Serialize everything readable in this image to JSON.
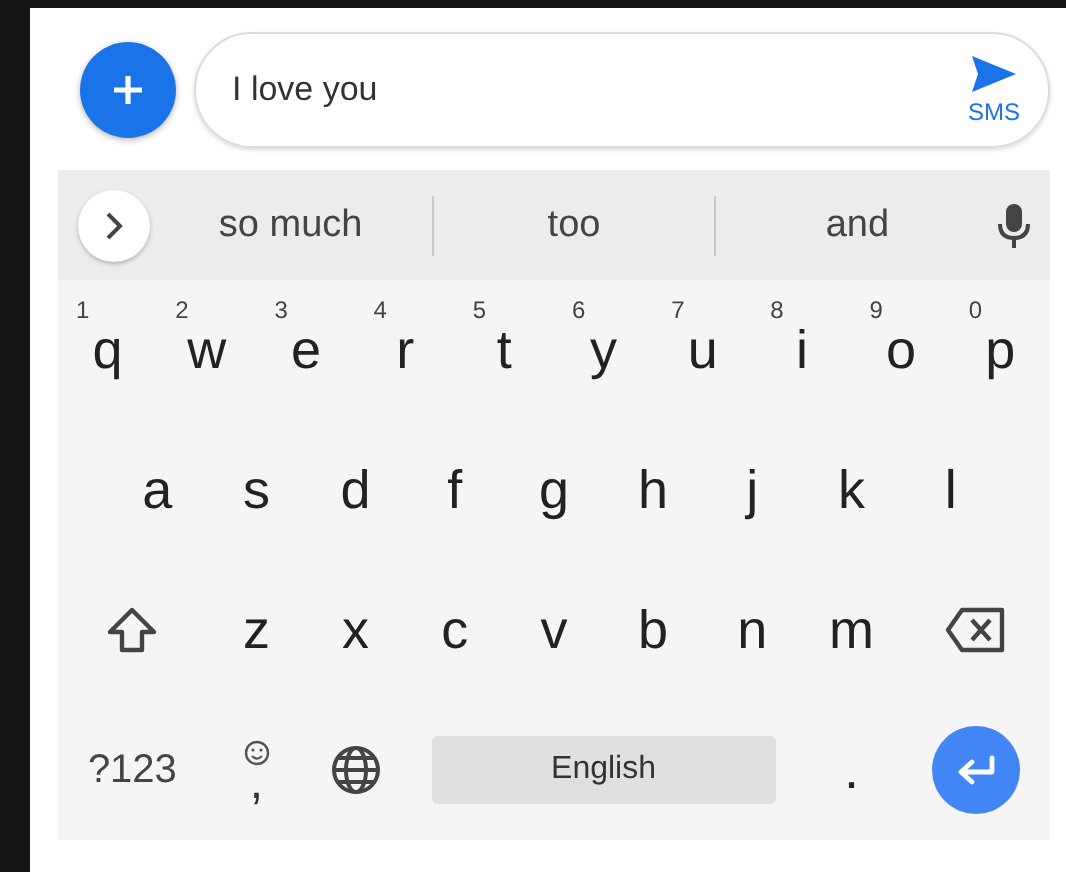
{
  "compose": {
    "value": "I love you",
    "send_label": "SMS"
  },
  "suggestions": [
    "so much",
    "too",
    "and"
  ],
  "keyboard": {
    "rows": [
      {
        "keys": [
          {
            "kind": "letter",
            "label": "q",
            "hint": "1"
          },
          {
            "kind": "letter",
            "label": "w",
            "hint": "2"
          },
          {
            "kind": "letter",
            "label": "e",
            "hint": "3"
          },
          {
            "kind": "letter",
            "label": "r",
            "hint": "4"
          },
          {
            "kind": "letter",
            "label": "t",
            "hint": "5"
          },
          {
            "kind": "letter",
            "label": "y",
            "hint": "6"
          },
          {
            "kind": "letter",
            "label": "u",
            "hint": "7"
          },
          {
            "kind": "letter",
            "label": "i",
            "hint": "8"
          },
          {
            "kind": "letter",
            "label": "o",
            "hint": "9"
          },
          {
            "kind": "letter",
            "label": "p",
            "hint": "0"
          }
        ]
      },
      {
        "keys": [
          {
            "kind": "letter",
            "label": "a"
          },
          {
            "kind": "letter",
            "label": "s"
          },
          {
            "kind": "letter",
            "label": "d"
          },
          {
            "kind": "letter",
            "label": "f"
          },
          {
            "kind": "letter",
            "label": "g"
          },
          {
            "kind": "letter",
            "label": "h"
          },
          {
            "kind": "letter",
            "label": "j"
          },
          {
            "kind": "letter",
            "label": "k"
          },
          {
            "kind": "letter",
            "label": "l"
          }
        ]
      },
      {
        "keys": [
          {
            "kind": "shift"
          },
          {
            "kind": "letter",
            "label": "z"
          },
          {
            "kind": "letter",
            "label": "x"
          },
          {
            "kind": "letter",
            "label": "c"
          },
          {
            "kind": "letter",
            "label": "v"
          },
          {
            "kind": "letter",
            "label": "b"
          },
          {
            "kind": "letter",
            "label": "n"
          },
          {
            "kind": "letter",
            "label": "m"
          },
          {
            "kind": "backspace"
          }
        ]
      },
      {
        "keys": [
          {
            "kind": "symbols",
            "label": "?123"
          },
          {
            "kind": "comma",
            "label": ","
          },
          {
            "kind": "globe"
          },
          {
            "kind": "space",
            "label": "English"
          },
          {
            "kind": "period",
            "label": "."
          },
          {
            "kind": "enter"
          }
        ]
      }
    ]
  }
}
